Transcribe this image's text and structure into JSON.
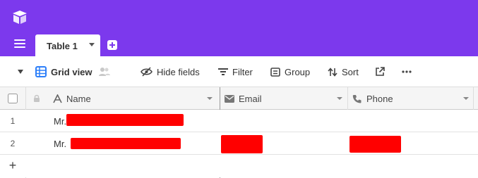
{
  "tab": {
    "label": "Table 1"
  },
  "toolbar": {
    "view_label": "Grid view",
    "hide_fields": "Hide fields",
    "filter": "Filter",
    "group": "Group",
    "sort": "Sort"
  },
  "columns": [
    {
      "label": "Name",
      "icon": "text-field-icon"
    },
    {
      "label": "Email",
      "icon": "email-field-icon"
    },
    {
      "label": "Phone",
      "icon": "phone-field-icon"
    }
  ],
  "rows": [
    {
      "num": "1",
      "name": "Mr.",
      "email": "",
      "phone": ""
    },
    {
      "num": "2",
      "name": "Mr.",
      "email": "",
      "phone": ""
    }
  ],
  "add_row_symbol": "+",
  "colors": {
    "brand": "#7c39ed",
    "view_icon": "#2d7ff9",
    "redaction": "#ff0000"
  }
}
